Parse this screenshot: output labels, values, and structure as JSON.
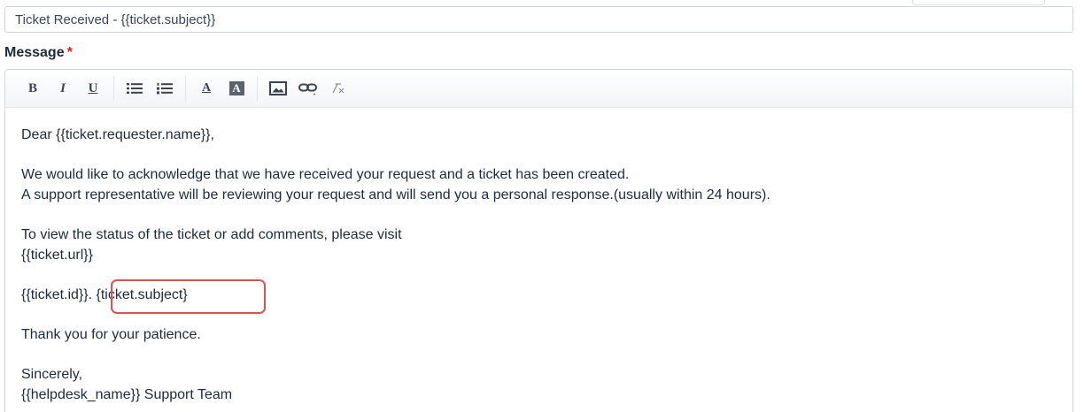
{
  "subject": {
    "value": "Ticket Received - {{ticket.subject}}"
  },
  "message": {
    "label": "Message",
    "required_marker": "*"
  },
  "toolbar": {
    "bold_label": "B",
    "italic_label": "I",
    "underline_label": "U",
    "text_color_label": "A",
    "bg_color_label": "A",
    "icons": [
      "bold-icon",
      "italic-icon",
      "underline-icon",
      "bullet-list-icon",
      "numbered-list-icon",
      "text-color-icon",
      "background-color-icon",
      "image-icon",
      "link-icon",
      "clear-format-icon"
    ]
  },
  "body": {
    "lines": [
      "Dear {{ticket.requester.name}},",
      "",
      "We would like to acknowledge that we have received your request and a ticket has been created.",
      "A support representative will be reviewing your request and will send you a personal response.(usually within 24 hours).",
      "",
      "To view the status of the ticket or add comments, please visit",
      "{{ticket.url}}",
      "",
      "{{ticket.id}}. {ticket.subject}",
      "",
      "Thank you for your patience.",
      "",
      "Sincerely,",
      "{{helpdesk_name}} Support Team"
    ]
  },
  "colors": {
    "required": "#e0201f",
    "highlight": "#d9534f",
    "text": "#1f2b3a",
    "border": "#cfd6de"
  }
}
